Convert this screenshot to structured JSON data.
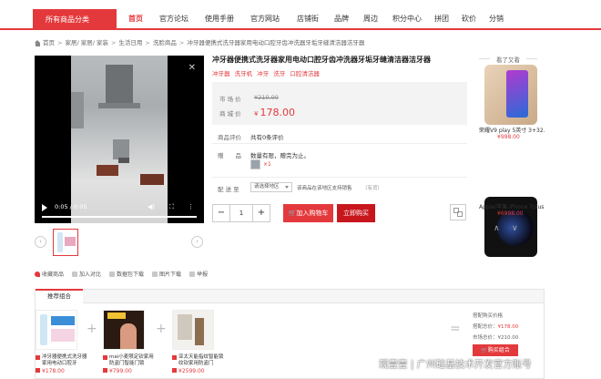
{
  "nav": {
    "all_categories": "所有商品分类",
    "items": [
      "首页",
      "官方论坛",
      "使用手册",
      "官方网站",
      "店铺街",
      "品牌",
      "周边",
      "积分中心",
      "拼团",
      "砍价",
      "分销"
    ]
  },
  "breadcrumb": [
    "首页",
    "家居/ 家居/ 家装",
    "生活日用",
    "洗脸商品",
    "冲牙器便携式洗牙器家用电动口腔牙齿冲洗器牙垢牙缝清洁器洁牙器"
  ],
  "video": {
    "time": "0:05 / 0:05"
  },
  "actions": [
    "收藏商品",
    "加入对比",
    "数据包下载",
    "图片下载",
    "举报"
  ],
  "product": {
    "title": "冲牙器便携式洗牙器家用电动口腔牙齿冲洗器牙垢牙缝清洁器洁牙器",
    "tags": [
      "冲牙器",
      "洗牙机",
      "冲牙",
      "洗牙",
      "口腔清洁器"
    ],
    "market_label": "市 场 价",
    "market_price": "¥210.00",
    "sale_label": "商 城 价",
    "sale_currency": "¥",
    "sale_price": "178.00",
    "review_label": "商品评价",
    "review_value": "共有0条评价",
    "gift_label": "赠　　品",
    "gift_text": "数量有限，赠完为止。",
    "gift_count": "×1",
    "ship_label": "配 送 至",
    "area_placeholder": "请选择地区",
    "support_note": "该商品在该地区支持销售",
    "stock_note": "（有货）",
    "qty": "1",
    "minus": "−",
    "plus": "+",
    "add_cart": "加入购物车",
    "buy_now": "立即购买"
  },
  "see_also": {
    "title": "看了又看",
    "items": [
      {
        "name": "荣耀V9 play 5英寸 3+32...",
        "price": "¥998.00"
      },
      {
        "name": "Apple/苹果 iPhone 7plus...",
        "price": "¥6998.00"
      }
    ]
  },
  "combo": {
    "tab": "推荐组合",
    "items": [
      {
        "name": "冲牙器便携式洗牙器家用电动口腔牙",
        "price": "¥178.00"
      },
      {
        "name": "mai小麦限定钦家用防盗门智能门锁",
        "price": "¥799.00"
      },
      {
        "name": "亚太天能指纹智能锁纹钦家用防盗门",
        "price": "¥2599.00"
      }
    ],
    "summary": {
      "buy_label": "搭配购买价格",
      "combo_label": "搭配总价：",
      "combo_value": "¥178.00",
      "market_label": "市场总价：",
      "market_value": "¥210.00",
      "buy_button": "购买组合"
    }
  },
  "watermark": "观壹壹 | 广州硅基技术开发官方账号"
}
